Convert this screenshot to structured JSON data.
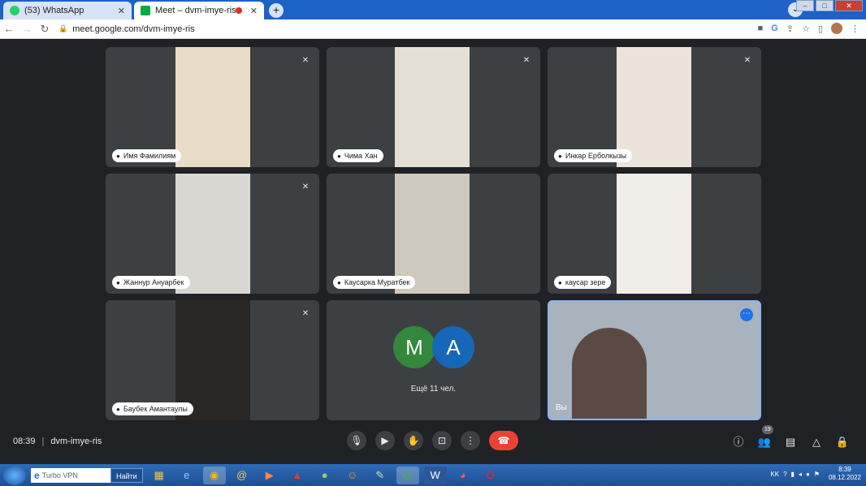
{
  "browser": {
    "tabs": [
      {
        "label": "(53) WhatsApp",
        "close": "✕",
        "icon_color": "#25d366"
      },
      {
        "label": "Meet – dvm-imye-ris",
        "close": "✕",
        "icon_color": "#00ac47"
      }
    ],
    "new_tab": "+",
    "url": "meet.google.com/dvm-imye-ris",
    "window_buttons": [
      "–",
      "□",
      "✕"
    ]
  },
  "meet": {
    "participants": [
      {
        "name": "Имя Фамилиям",
        "video_color": "#e8dcc6"
      },
      {
        "name": "Чима Хан",
        "video_color": "#e6dfd3"
      },
      {
        "name": "Инкар Ерболкызы",
        "video_color": "#ece3db"
      },
      {
        "name": "Жаннур Ануарбек",
        "video_color": "#d9d7d2"
      },
      {
        "name": "Каусарка Муратбек",
        "video_color": "#cfc8bd"
      },
      {
        "name": "каусар зере",
        "video_color": "#f1ede8"
      },
      {
        "name": "Баубек Амантаулы",
        "video_color": "#2a2624"
      }
    ],
    "more_tile": {
      "avatars": [
        {
          "letter": "M",
          "color": "#33883b"
        },
        {
          "letter": "A",
          "color": "#1767b8"
        }
      ],
      "label": "Ещё 11 чел."
    },
    "self_tile": {
      "name": "Вы"
    },
    "time": "08:39",
    "meeting_code": "dvm-imye-ris",
    "participant_count": "19"
  },
  "taskbar": {
    "search_text": "Turbo VPN",
    "find_button": "Найти",
    "tray_lang": "KK",
    "clock_time": "8:39",
    "clock_date": "08.12.2022"
  },
  "colors": {
    "meet_bg": "#202124",
    "tile_bg": "#3c4043",
    "end_call": "#ea4335",
    "accent": "#1a73e8"
  }
}
